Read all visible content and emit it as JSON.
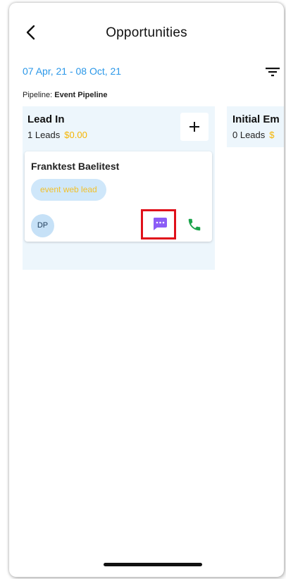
{
  "header": {
    "title": "Opportunities"
  },
  "date_range": "07 Apr, 21 - 08 Oct, 21",
  "pipeline": {
    "label": "Pipeline:",
    "value": "Event Pipeline"
  },
  "columns": [
    {
      "title": "Lead In",
      "count": "1 Leads",
      "amount": "$0.00",
      "cards": [
        {
          "name": "Franktest Baelitest",
          "tag": "event web lead",
          "avatar": "DP"
        }
      ]
    },
    {
      "title": "Initial Em",
      "count": "0 Leads",
      "amount": "$"
    }
  ],
  "colors": {
    "accent_blue": "#2a97e8",
    "amount_yellow": "#f5b400",
    "message_purple": "#8b5cf6",
    "phone_green": "#1aa34a",
    "highlight_red": "#e0101a"
  },
  "icons": [
    "back-arrow-icon",
    "filter-icon",
    "plus-icon",
    "message-icon",
    "phone-icon"
  ]
}
